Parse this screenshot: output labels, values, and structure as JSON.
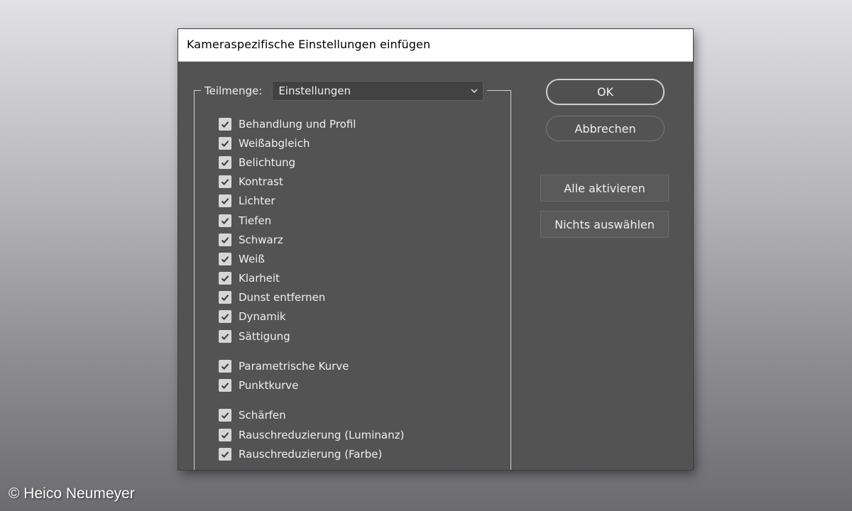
{
  "dialog": {
    "title": "Kameraspezifische Einstellungen einfügen",
    "subset_label": "Teilmenge:",
    "subset_selected": "Einstellungen",
    "checkboxes": [
      {
        "label": "Behandlung und Profil",
        "checked": true
      },
      {
        "label": "Weißabgleich",
        "checked": true
      },
      {
        "label": "Belichtung",
        "checked": true
      },
      {
        "label": "Kontrast",
        "checked": true
      },
      {
        "label": "Lichter",
        "checked": true
      },
      {
        "label": "Tiefen",
        "checked": true
      },
      {
        "label": "Schwarz",
        "checked": true
      },
      {
        "label": "Weiß",
        "checked": true
      },
      {
        "label": "Klarheit",
        "checked": true
      },
      {
        "label": "Dunst entfernen",
        "checked": true
      },
      {
        "label": "Dynamik",
        "checked": true
      },
      {
        "label": "Sättigung",
        "checked": true
      },
      {
        "label": "Parametrische Kurve",
        "checked": true
      },
      {
        "label": "Punktkurve",
        "checked": true
      },
      {
        "label": "Schärfen",
        "checked": true
      },
      {
        "label": "Rauschreduzierung (Luminanz)",
        "checked": true
      },
      {
        "label": "Rauschreduzierung (Farbe)",
        "checked": true
      }
    ],
    "buttons": {
      "ok": "OK",
      "cancel": "Abbrechen",
      "select_all": "Alle aktivieren",
      "select_none": "Nichts auswählen"
    }
  },
  "credit": "© Heico Neumeyer",
  "icons": {
    "checkbox_check": "checkmark-icon",
    "dropdown": "chevron-down-icon"
  },
  "colors": {
    "dialog_bg": "#535353",
    "titlebar_bg": "#ffffff",
    "checkbox_bg": "#d6d6d6",
    "text": "#f0f0f0"
  }
}
